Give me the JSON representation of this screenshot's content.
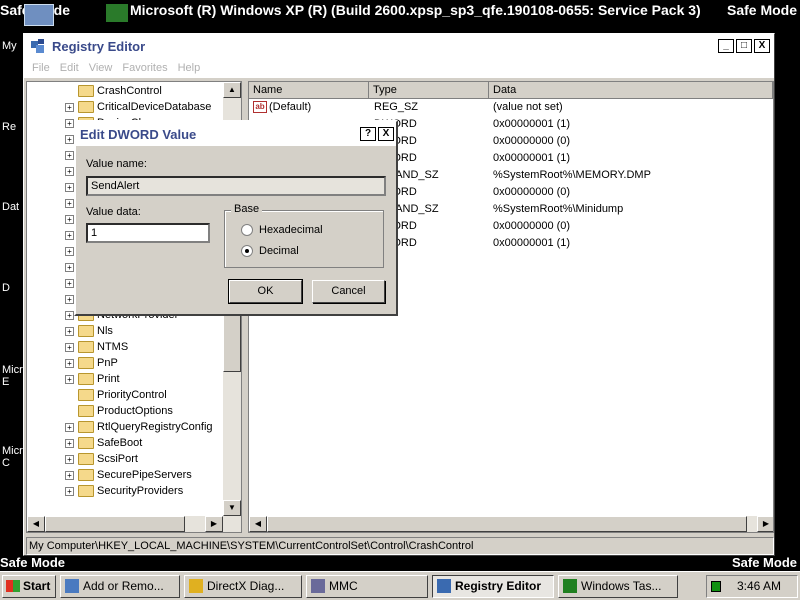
{
  "desktop": {
    "top_left": "Safe Mode",
    "top_center": "Microsoft (R) Windows XP (R) (Build 2600.xpsp_sp3_qfe.190108-0655: Service Pack 3)",
    "top_right": "Safe Mode",
    "bottom_left": "Safe Mode",
    "bottom_right": "Safe Mode",
    "icon_labels": [
      "My",
      "Re",
      "Dat",
      "D",
      "Micr\nE",
      "Micr\nC"
    ]
  },
  "window": {
    "title": "Registry Editor",
    "minimize": "_",
    "maximize": "□",
    "close": "X",
    "menu": [
      "File",
      "Edit",
      "View",
      "Favorites",
      "Help"
    ]
  },
  "tree": {
    "items": [
      {
        "label": "CrashControl",
        "expand": ""
      },
      {
        "label": "CriticalDeviceDatabase",
        "expand": "+"
      },
      {
        "label": "DeviceClasses",
        "expand": "+"
      },
      {
        "label": "",
        "expand": "+"
      },
      {
        "label": "",
        "expand": "+"
      },
      {
        "label": "",
        "expand": "+"
      },
      {
        "label": "",
        "expand": "+"
      },
      {
        "label": "",
        "expand": "+"
      },
      {
        "label": "",
        "expand": "+"
      },
      {
        "label": "",
        "expand": "+"
      },
      {
        "label": "",
        "expand": "+"
      },
      {
        "label": "",
        "expand": "+"
      },
      {
        "label": "",
        "expand": "+"
      },
      {
        "label": "",
        "expand": "+"
      },
      {
        "label": "NetworkProvider",
        "expand": "+"
      },
      {
        "label": "Nls",
        "expand": "+"
      },
      {
        "label": "NTMS",
        "expand": "+"
      },
      {
        "label": "PnP",
        "expand": "+"
      },
      {
        "label": "Print",
        "expand": "+"
      },
      {
        "label": "PriorityControl",
        "expand": ""
      },
      {
        "label": "ProductOptions",
        "expand": ""
      },
      {
        "label": "RtlQueryRegistryConfig",
        "expand": "+"
      },
      {
        "label": "SafeBoot",
        "expand": "+"
      },
      {
        "label": "ScsiPort",
        "expand": "+"
      },
      {
        "label": "SecurePipeServers",
        "expand": "+"
      },
      {
        "label": "SecurityProviders",
        "expand": "+"
      }
    ]
  },
  "list": {
    "columns": [
      "Name",
      "Type",
      "Data"
    ],
    "rows": [
      {
        "name": "(Default)",
        "type": "REG_SZ",
        "data": "(value not set)",
        "icon": "ab"
      },
      {
        "name": "",
        "type": "DWORD",
        "data": "0x00000001 (1)",
        "icon": ""
      },
      {
        "name": "",
        "type": "DWORD",
        "data": "0x00000000 (0)",
        "icon": ""
      },
      {
        "name": "",
        "type": "DWORD",
        "data": "0x00000001 (1)",
        "icon": ""
      },
      {
        "name": "",
        "type": "EXPAND_SZ",
        "data": "%SystemRoot%\\MEMORY.DMP",
        "icon": ""
      },
      {
        "name": "",
        "type": "DWORD",
        "data": "0x00000000 (0)",
        "icon": ""
      },
      {
        "name": "",
        "type": "EXPAND_SZ",
        "data": "%SystemRoot%\\Minidump",
        "icon": ""
      },
      {
        "name": "",
        "type": "DWORD",
        "data": "0x00000000 (0)",
        "icon": ""
      },
      {
        "name": "",
        "type": "DWORD",
        "data": "0x00000001 (1)",
        "icon": ""
      }
    ]
  },
  "status_path": "My Computer\\HKEY_LOCAL_MACHINE\\SYSTEM\\CurrentControlSet\\Control\\CrashControl",
  "dialog": {
    "title": "Edit DWORD Value",
    "help": "?",
    "close": "X",
    "value_name_label": "Value name:",
    "value_name": "SendAlert",
    "value_data_label": "Value data:",
    "value_data": "1",
    "base_label": "Base",
    "hex_label": "Hexadecimal",
    "dec_label": "Decimal",
    "selected_base": "Decimal",
    "ok": "OK",
    "cancel": "Cancel"
  },
  "taskbar": {
    "start": "Start",
    "tasks": [
      {
        "label": "Add or Remo...",
        "icon": "control-panel-icon",
        "active": false
      },
      {
        "label": "DirectX Diag...",
        "icon": "directx-icon",
        "active": false
      },
      {
        "label": "MMC",
        "icon": "mmc-icon",
        "active": false
      },
      {
        "label": "Registry Editor",
        "icon": "regedit-icon",
        "active": true
      },
      {
        "label": "Windows Tas...",
        "icon": "task-manager-icon",
        "active": false
      }
    ],
    "clock": "3:46 AM"
  }
}
